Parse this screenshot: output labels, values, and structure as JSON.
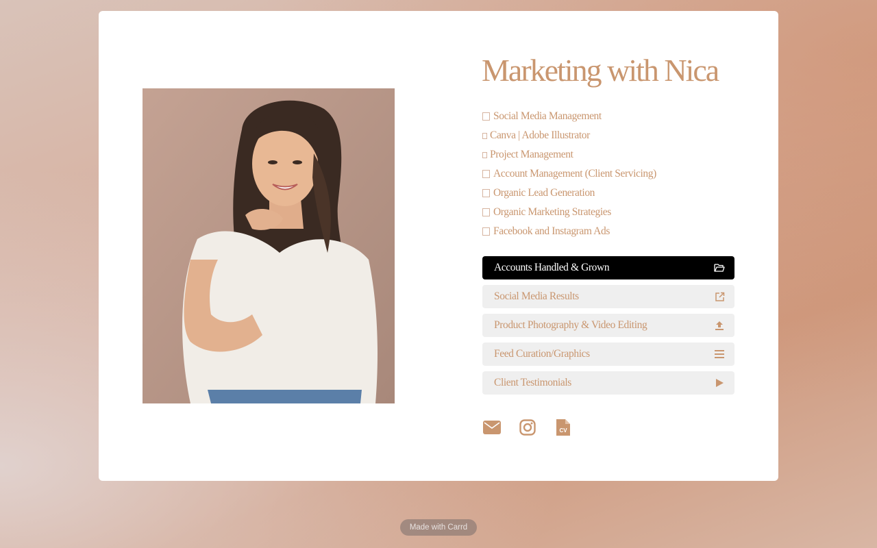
{
  "profile": {
    "title": "Marketing with Nica",
    "photo_alt": "Portrait photo"
  },
  "skills": [
    {
      "label": "Social Media Management",
      "marker": "box"
    },
    {
      "label": "Canva | Adobe Illustrator",
      "marker": "small"
    },
    {
      "label": "Project Management",
      "marker": "small"
    },
    {
      "label": "Account Management (Client Servicing)",
      "marker": "box"
    },
    {
      "label": "Organic Lead Generation",
      "marker": "box"
    },
    {
      "label": "Organic Marketing Strategies",
      "marker": "box"
    },
    {
      "label": "Facebook and Instagram Ads",
      "marker": "box"
    }
  ],
  "buttons": [
    {
      "label": "Accounts Handled & Grown",
      "icon": "folder-open-icon",
      "active": true
    },
    {
      "label": "Social Media Results",
      "icon": "external-link-icon",
      "active": false
    },
    {
      "label": "Product Photography & Video Editing",
      "icon": "upload-icon",
      "active": false
    },
    {
      "label": "Feed Curation/Graphics",
      "icon": "menu-icon",
      "active": false
    },
    {
      "label": "Client Testimonials",
      "icon": "play-icon",
      "active": false
    }
  ],
  "socials": [
    {
      "icon": "email-icon"
    },
    {
      "icon": "instagram-icon"
    },
    {
      "icon": "cv-file-icon",
      "label": "CV"
    }
  ],
  "footer": {
    "badge": "Made with Carrd"
  },
  "colors": {
    "accent": "#c9966f",
    "button_bg": "#efefef",
    "active_bg": "#000000"
  }
}
